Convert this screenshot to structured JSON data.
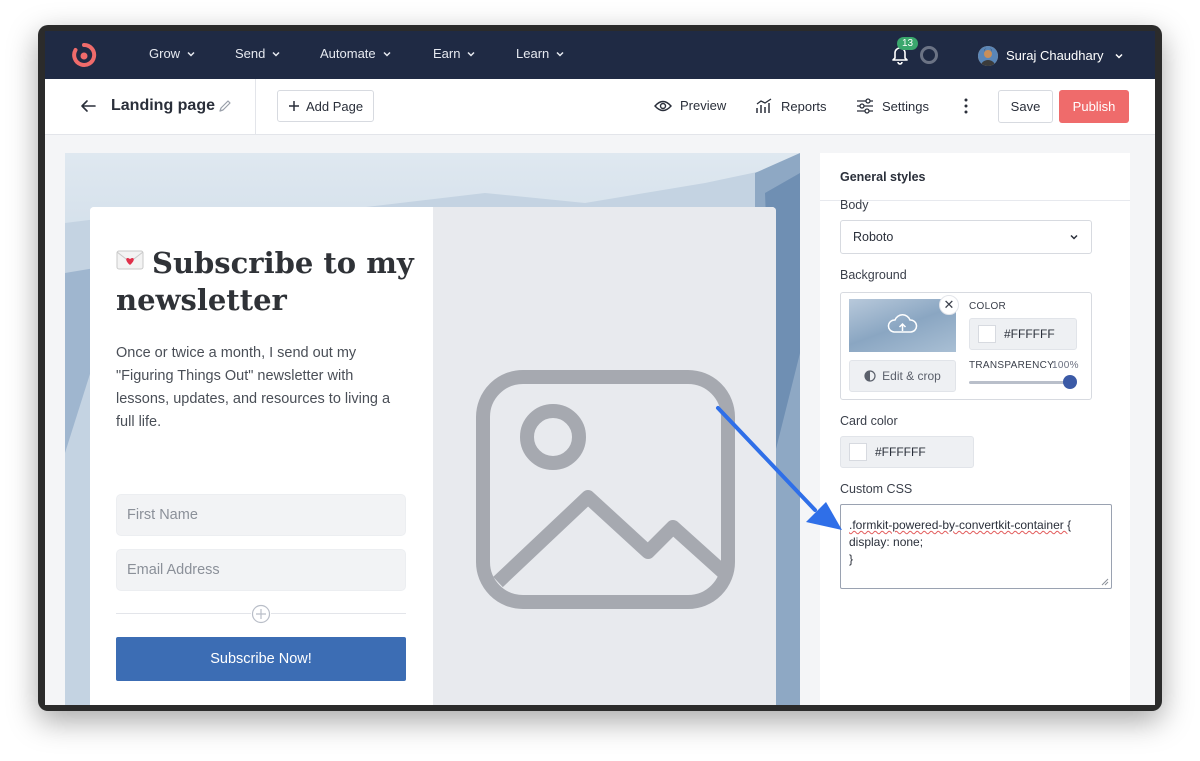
{
  "nav": {
    "items": [
      {
        "label": "Grow"
      },
      {
        "label": "Send"
      },
      {
        "label": "Automate"
      },
      {
        "label": "Earn"
      },
      {
        "label": "Learn"
      }
    ],
    "notification_count": "13",
    "user_name": "Suraj Chaudhary",
    "brand_color": "#ef6b6b",
    "bar_color": "#1f2a44"
  },
  "toolbar": {
    "page_title": "Landing page",
    "add_page_label": "Add Page",
    "preview_label": "Preview",
    "reports_label": "Reports",
    "settings_label": "Settings",
    "save_label": "Save",
    "publish_label": "Publish",
    "publish_color": "#ef6b6b"
  },
  "landing": {
    "headline": "Subscribe to my newsletter",
    "description": "Once or twice a month, I send out my \"Figuring Things Out\" newsletter with lessons, updates, and resources to living a full life.",
    "first_name_placeholder": "First Name",
    "email_placeholder": "Email Address",
    "subscribe_label": "Subscribe Now!",
    "button_color": "#3c6db4"
  },
  "panel": {
    "title": "General styles",
    "body_label": "Body",
    "body_font": "Roboto",
    "background_label": "Background",
    "color_label": "COLOR",
    "color_value": "#FFFFFF",
    "transparency_label": "TRANSPARENCY",
    "transparency_value": "100%",
    "edit_crop_label": "Edit & crop",
    "card_color_label": "Card color",
    "card_color_value": "#FFFFFF",
    "custom_css_label": "Custom CSS",
    "custom_css_lines": [
      ".formkit-powered-by-convertkit-container {",
      "display: none;",
      "}"
    ]
  },
  "annotation": {
    "arrow_color": "#2f6fe8"
  }
}
